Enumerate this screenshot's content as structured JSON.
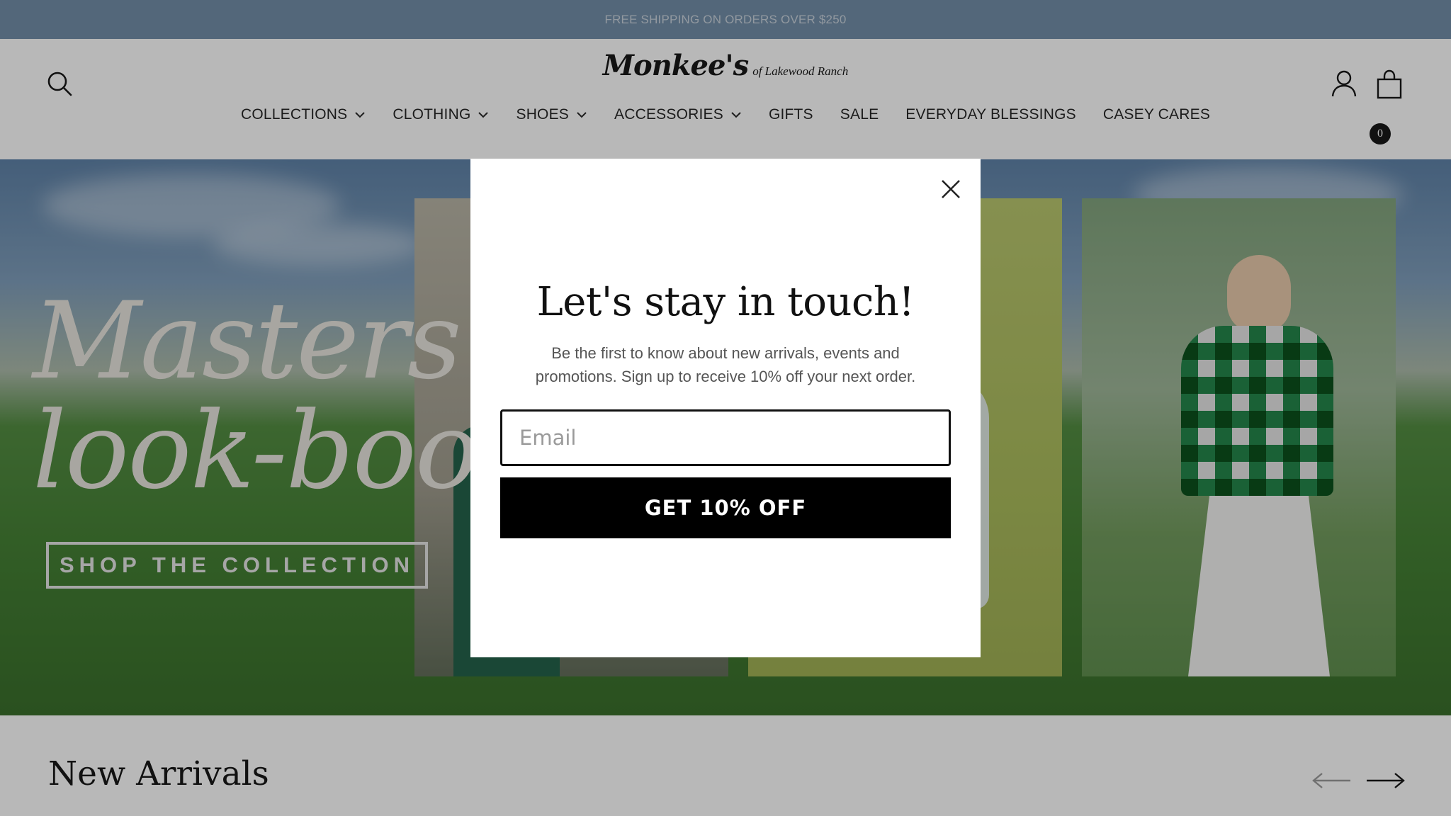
{
  "announcement": {
    "text": "FREE SHIPPING ON ORDERS OVER $250"
  },
  "header": {
    "logo_main": "Monkee's",
    "logo_sub": "of Lakewood Ranch",
    "cart_count": "0",
    "nav": [
      {
        "label": "COLLECTIONS",
        "has_dropdown": true
      },
      {
        "label": "CLOTHING",
        "has_dropdown": true
      },
      {
        "label": "SHOES",
        "has_dropdown": true
      },
      {
        "label": "ACCESSORIES",
        "has_dropdown": true
      },
      {
        "label": "GIFTS",
        "has_dropdown": false
      },
      {
        "label": "SALE",
        "has_dropdown": false
      },
      {
        "label": "EVERYDAY BLESSINGS",
        "has_dropdown": false
      },
      {
        "label": "CASEY CARES",
        "has_dropdown": false
      }
    ],
    "icons": [
      "search-icon",
      "account-icon",
      "cart-icon",
      "chevron-down-icon"
    ]
  },
  "hero": {
    "title_line1": "Masters",
    "title_line2": "look-book",
    "cta_label": "SHOP THE COLLECTION"
  },
  "section": {
    "title": "New Arrivals",
    "icons": [
      "arrow-left-icon",
      "arrow-right-icon"
    ]
  },
  "modal": {
    "title": "Let's stay in touch!",
    "body": "Be the first to know about new arrivals, events and promotions. Sign up to receive 10% off your next order.",
    "email_placeholder": "Email",
    "email_value": "",
    "submit_label": "GET 10% OFF",
    "close_icon": "close-icon"
  },
  "colors": {
    "announcement_bg": "#6f8ba6",
    "button_bg": "#000000",
    "overlay": "rgba(20,20,20,0.30)"
  }
}
